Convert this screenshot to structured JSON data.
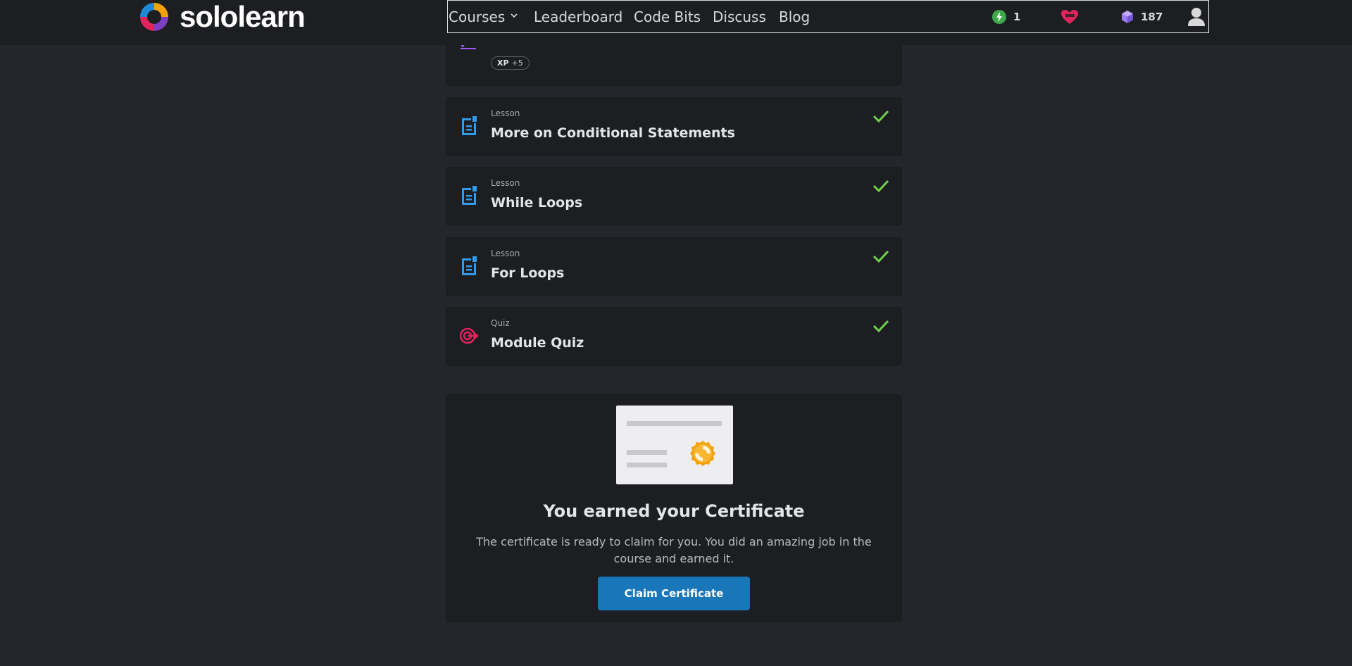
{
  "brand": {
    "name": "sololearn"
  },
  "nav": {
    "courses": "Courses",
    "leaderboard": "Leaderboard",
    "code_bits": "Code Bits",
    "discuss": "Discuss",
    "blog": "Blog"
  },
  "stats": {
    "streak": "1",
    "gems": "187"
  },
  "partial_item": {
    "xp_label": "XP",
    "xp_value": "+5"
  },
  "lessons": [
    {
      "type": "Lesson",
      "title": "More on Conditional Statements",
      "completed": true
    },
    {
      "type": "Lesson",
      "title": "While Loops",
      "completed": true
    },
    {
      "type": "Lesson",
      "title": "For Loops",
      "completed": true
    },
    {
      "type": "Quiz",
      "title": "Module Quiz",
      "completed": true
    }
  ],
  "certificate": {
    "title": "You earned your Certificate",
    "description": "The certificate is ready to claim for you. You did an amazing job in the course and earned it.",
    "button_label": "Claim Certificate"
  },
  "colors": {
    "page_bg": "#24262b",
    "card_bg": "#1c1e21",
    "lesson_icon": "#2f9bea",
    "quiz_icon": "#e0245e",
    "check": "#6fd34c",
    "accent_button": "#1976b8",
    "streak": "#3fa84a",
    "heart": "#e0245e",
    "gem": "#9a7cf0"
  },
  "icons": {
    "lesson": "lesson-doc-icon",
    "quiz": "target-arrow-icon",
    "check": "check-icon",
    "streak": "lightning-icon",
    "hearts": "infinite-heart-icon",
    "gems": "gem-cube-icon",
    "profile": "user-avatar-icon"
  }
}
